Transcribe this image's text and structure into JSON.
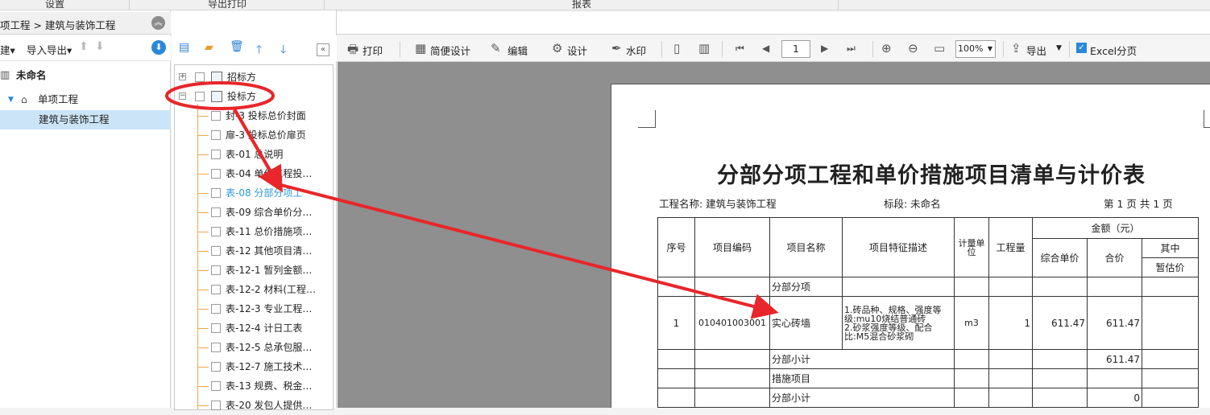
{
  "top_tabs": {
    "settings": "设置",
    "export_print": "导出打印",
    "reports": "报表"
  },
  "breadcrumb": "项工程 > 建筑与装饰工程",
  "left_toolbar": {
    "new": "建▾",
    "import_export": "导入导出▾"
  },
  "project_tree": {
    "root": "未命名",
    "unit": "单项工程",
    "selected": "建筑与装饰工程"
  },
  "report_tree": {
    "groups": [
      "招标方",
      "投标方"
    ],
    "items": [
      "封-3 投标总价封面",
      "扉-3 投标总价扉页",
      "表-01 总说明",
      "表-04 单位工程投…",
      "表-08 分部分项工",
      "表-09 综合单价分…",
      "表-11 总价措施项…",
      "表-12 其他项目清…",
      "表-12-1 暂列金额…",
      "表-12-2 材料(工程…",
      "表-12-3 专业工程…",
      "表-12-4 计日工表",
      "表-12-5 总承包服…",
      "表-12-7 施工技术…",
      "表-13 规费、税金…",
      "表-20 发包人提供…"
    ],
    "selected_index": 4
  },
  "viewer_toolbar": {
    "print": "打印",
    "easy_design": "简便设计",
    "edit": "编辑",
    "design": "设计",
    "watermark": "水印",
    "page": "1",
    "zoom": "100%",
    "export": "导出",
    "excel_split": "Excel分页"
  },
  "report": {
    "title": "分部分项工程和单价措施项目清单与计价表",
    "project_name": "工程名称: 建筑与装饰工程",
    "section": "标段: 未命名",
    "page_info": "第  1  页   共  1  页",
    "headers": {
      "seq": "序号",
      "code": "项目编码",
      "name": "项目名称",
      "desc": "项目特征描述",
      "unit": "计量单位",
      "qty": "工程量",
      "amount": "金额（元）",
      "unit_price": "综合单价",
      "total": "合价",
      "of_which": "其中",
      "provisional": "暂估价"
    },
    "rows": {
      "section1": "分部分项",
      "seq": "1",
      "code": "010401003001",
      "name": "实心砖墙",
      "desc": "1.砖品种、规格、强度等级:mu10烧结普通砖\n2.砂浆强度等级、配合比:M5混合砂浆砌",
      "unit": "m3",
      "qty": "1",
      "unit_price": "611.47",
      "total": "611.47",
      "subtotal_label": "分部小计",
      "subtotal": "611.47",
      "section2": "措施项目",
      "subtotal2_label": "分部小计",
      "subtotal2": "0"
    }
  }
}
